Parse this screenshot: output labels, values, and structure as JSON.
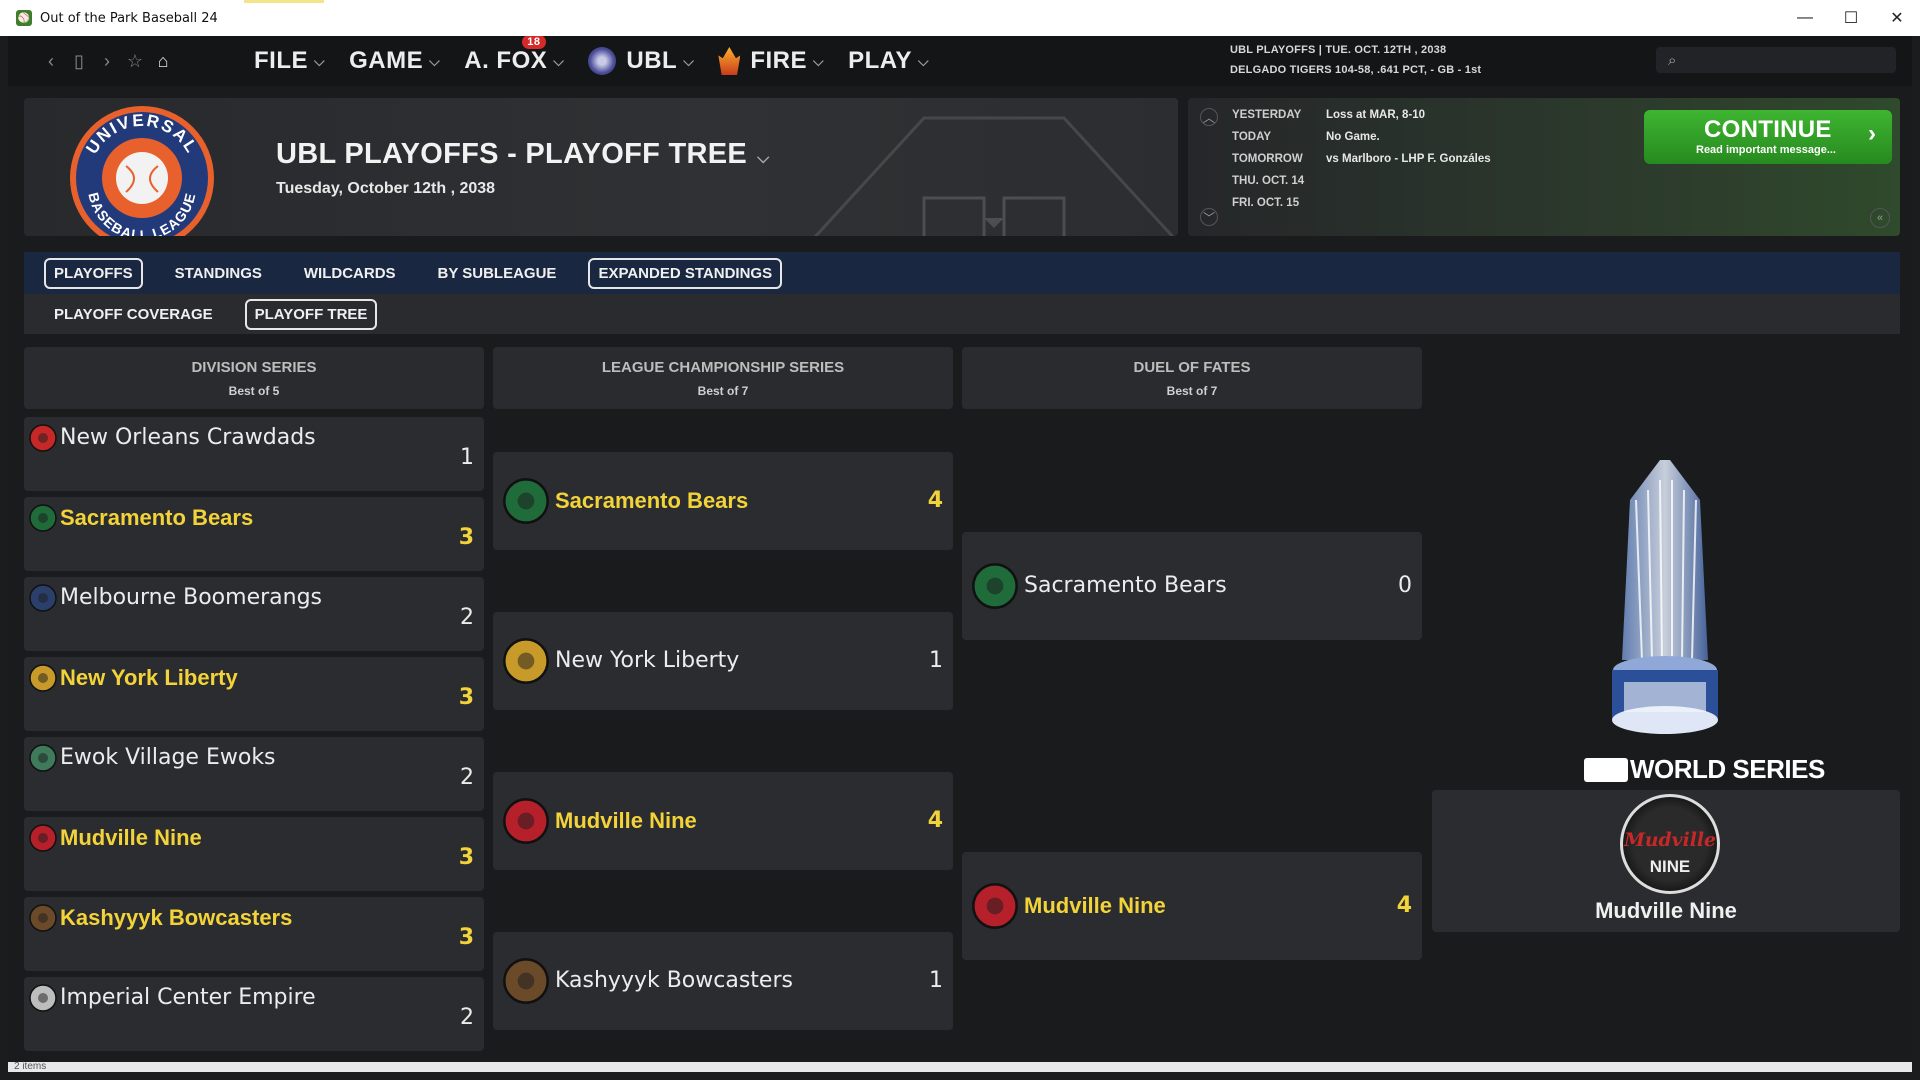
{
  "window": {
    "title": "Out of the Park Baseball 24",
    "minimize": "—",
    "maximize": "☐",
    "close": "✕"
  },
  "nav": {
    "back": "‹",
    "bookmark_page": "▯",
    "forward": "›",
    "star": "☆",
    "home": "⌂",
    "menus": [
      {
        "label": "FILE"
      },
      {
        "label": "GAME"
      },
      {
        "label": "A. FOX",
        "badge": "18"
      },
      {
        "label": "UBL"
      },
      {
        "label": "FIRE"
      },
      {
        "label": "PLAY"
      }
    ],
    "status_line1": "UBL PLAYOFFS  |  TUE. OCT. 12TH , 2038",
    "status_line2": "DELGADO TIGERS  104-58, .641 PCT, - GB - 1st",
    "search_placeholder": ""
  },
  "header": {
    "title": "UBL PLAYOFFS - PLAYOFF TREE",
    "date": "Tuesday, October 12th , 2038",
    "logo_text": "UNIVERSAL BASEBALL LEAGUE"
  },
  "schedule": [
    {
      "label": "YESTERDAY",
      "value": "Loss at MAR, 8-10"
    },
    {
      "label": "TODAY",
      "value": "No Game."
    },
    {
      "label": "TOMORROW",
      "value": "vs Marlboro - LHP F. Gonzáles"
    },
    {
      "label": "THU. OCT. 14",
      "value": ""
    },
    {
      "label": "FRI. OCT. 15",
      "value": ""
    }
  ],
  "continue": {
    "label": "CONTINUE",
    "sub": "Read important message...",
    "arrow": "›"
  },
  "tabs_primary": [
    "PLAYOFFS",
    "STANDINGS",
    "WILDCARDS",
    "BY SUBLEAGUE",
    "EXPANDED STANDINGS"
  ],
  "tabs_secondary": [
    "PLAYOFF COVERAGE",
    "PLAYOFF TREE"
  ],
  "columns": [
    {
      "title": "DIVISION SERIES",
      "sub": "Best of 5"
    },
    {
      "title": "LEAGUE CHAMPIONSHIP SERIES",
      "sub": "Best of 7"
    },
    {
      "title": "DUEL OF FATES",
      "sub": "Best of 7"
    }
  ],
  "division_series": [
    {
      "team": "New Orleans Crawdads",
      "score": "1",
      "winner": false,
      "color": "#c62828"
    },
    {
      "team": "Sacramento Bears",
      "score": "3",
      "winner": true,
      "color": "#1f6b3a"
    },
    {
      "team": "Melbourne Boomerangs",
      "score": "2",
      "winner": false,
      "color": "#2b3f6b"
    },
    {
      "team": "New York Liberty",
      "score": "3",
      "winner": true,
      "color": "#c89a2a"
    },
    {
      "team": "Ewok Village Ewoks",
      "score": "2",
      "winner": false,
      "color": "#3f7a5a"
    },
    {
      "team": "Mudville Nine",
      "score": "3",
      "winner": true,
      "color": "#b5202a"
    },
    {
      "team": "Kashyyyk Bowcasters",
      "score": "3",
      "winner": true,
      "color": "#6b4a2a"
    },
    {
      "team": "Imperial Center Empire",
      "score": "2",
      "winner": false,
      "color": "#bdbdbd"
    }
  ],
  "lcs": [
    {
      "team": "Sacramento Bears",
      "score": "4",
      "winner": true,
      "color": "#1f6b3a"
    },
    {
      "team": "New York Liberty",
      "score": "1",
      "winner": false,
      "color": "#c89a2a"
    },
    {
      "team": "Mudville Nine",
      "score": "4",
      "winner": true,
      "color": "#b5202a"
    },
    {
      "team": "Kashyyyk Bowcasters",
      "score": "1",
      "winner": false,
      "color": "#6b4a2a"
    }
  ],
  "finals": [
    {
      "team": "Sacramento Bears",
      "score": "0",
      "winner": false,
      "color": "#1f6b3a"
    },
    {
      "team": "Mudville Nine",
      "score": "4",
      "winner": true,
      "color": "#b5202a"
    }
  ],
  "world_series": {
    "label": "WORLD SERIES",
    "champion": "Mudville Nine",
    "champion_logo_text": "Mudville NINE"
  },
  "statusbar": "2 items"
}
